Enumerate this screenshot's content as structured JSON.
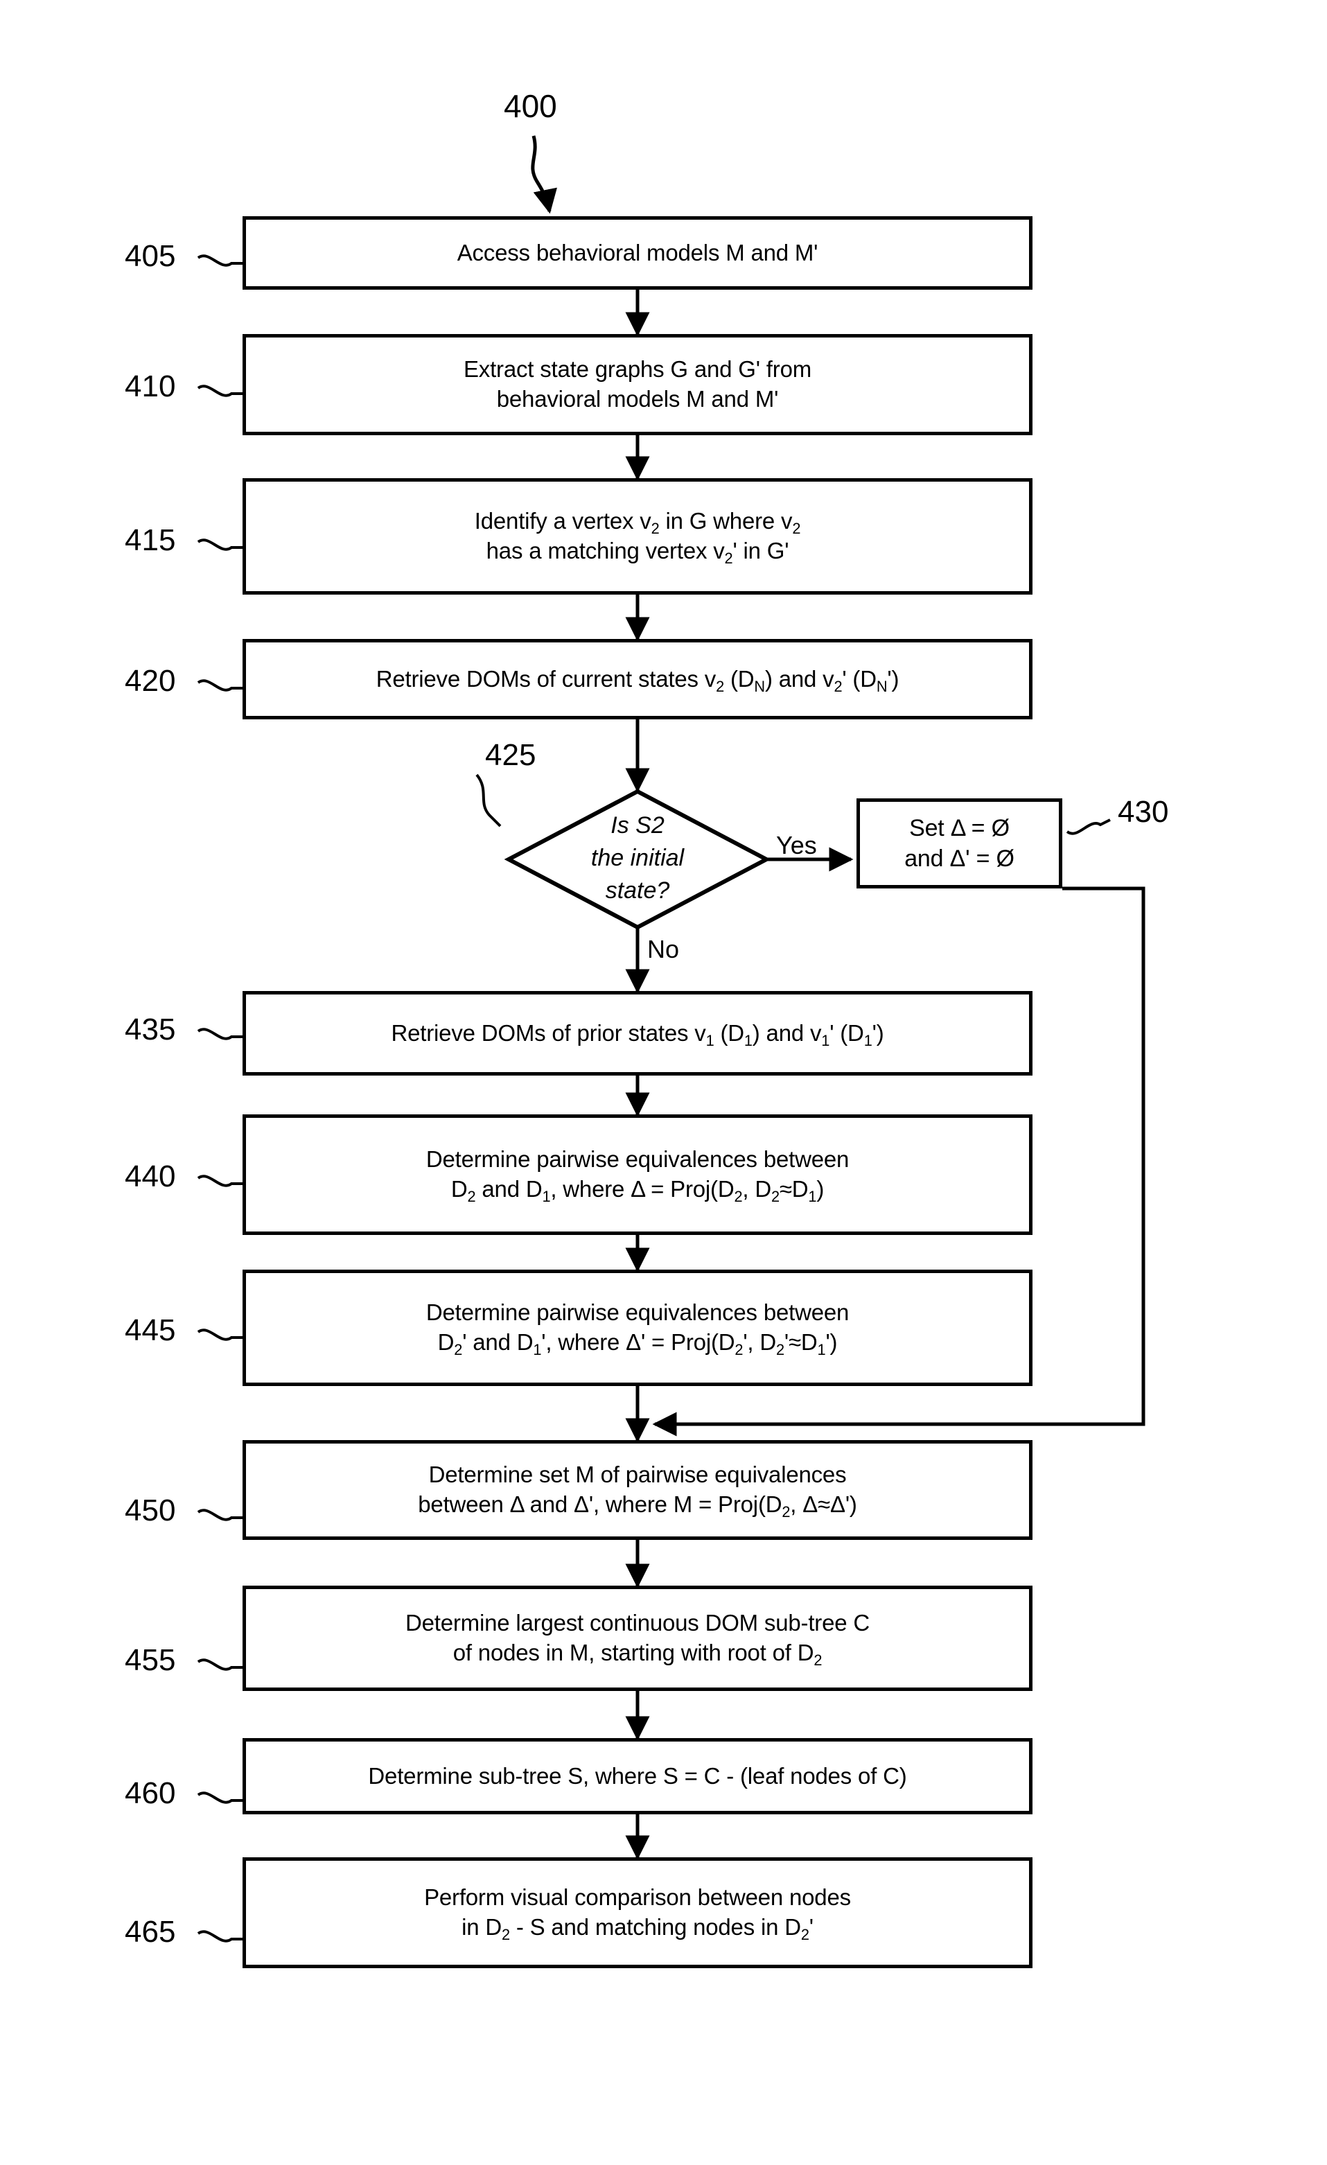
{
  "figure": {
    "number": "400"
  },
  "nodes": [
    {
      "ref": "405",
      "text": "Access behavioral models M and M'",
      "shape": "process"
    },
    {
      "ref": "410",
      "text": "Extract state graphs G and G' from\nbehavioral models M and M'",
      "shape": "process"
    },
    {
      "ref": "415",
      "text": "Identify a vertex v2 in G where v2\nhas a matching vertex v2' in G'",
      "shape": "process"
    },
    {
      "ref": "420",
      "text": "Retrieve DOMs of current states v2 (DN) and v2' (DN')",
      "shape": "process"
    },
    {
      "ref": "425",
      "text": "Is S2\nthe initial\nstate?",
      "shape": "decision"
    },
    {
      "ref": "430",
      "text": "Set Δ = Ø\nand Δ' = Ø",
      "shape": "process"
    },
    {
      "ref": "435",
      "text": "Retrieve DOMs of prior states v1 (D1) and v1' (D1')",
      "shape": "process"
    },
    {
      "ref": "440",
      "text": "Determine pairwise equivalences between\nD2 and D1, where Δ = Proj(D2, D2≈D1)",
      "shape": "process"
    },
    {
      "ref": "445",
      "text": "Determine pairwise equivalences between\nD2' and D1', where Δ' = Proj(D2', D2'≈D1')",
      "shape": "process"
    },
    {
      "ref": "450",
      "text": "Determine set M of pairwise equivalences\nbetween Δ and Δ', where M = Proj(D2, Δ≈Δ')",
      "shape": "process"
    },
    {
      "ref": "455",
      "text": "Determine largest continuous DOM sub-tree C\nof nodes in M, starting with root of D2",
      "shape": "process"
    },
    {
      "ref": "460",
      "text": "Determine sub-tree S, where S = C - (leaf nodes of C)",
      "shape": "process"
    },
    {
      "ref": "465",
      "text": "Perform visual comparison between nodes\nin D2 - S and matching nodes in D2'",
      "shape": "process"
    }
  ],
  "edge_labels": {
    "yes": "Yes",
    "no": "No"
  },
  "colors": {
    "stroke": "#000000",
    "fill": "#ffffff"
  }
}
